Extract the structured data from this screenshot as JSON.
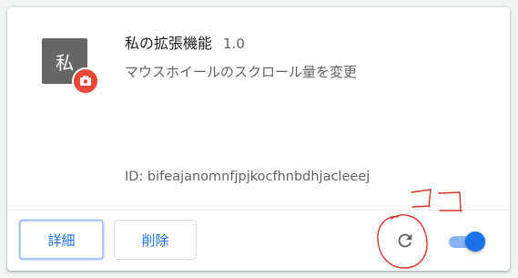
{
  "extension": {
    "icon_char": "私",
    "name": "私の拡張機能",
    "version": "1.0",
    "description": "マウスホイールのスクロール量を変更",
    "id_text": "ID: bifeajanomnfjpjkocfhnbdhjacleeej",
    "enabled": true
  },
  "buttons": {
    "details_label": "詳細",
    "remove_label": "削除"
  },
  "annotation": {
    "handwritten_text": "ココ",
    "color": "#d9342b"
  },
  "colors": {
    "accent": "#1a73e8",
    "badge": "#e8483a",
    "icon_bg": "#666666"
  },
  "icons": {
    "reload": "reload-icon",
    "badge": "puzzle-badge-icon"
  }
}
